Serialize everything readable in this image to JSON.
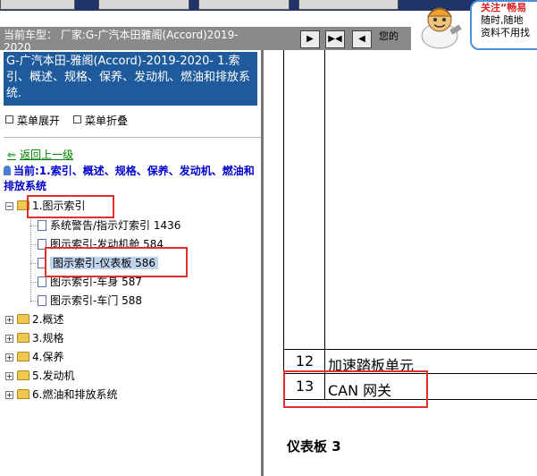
{
  "header": {
    "vehicle_label": "当前车型：",
    "vehicle_value": "厂家:G-广汽本田雅阁(Accord)2019-2020",
    "nav_buttons": [
      "▶",
      "▶◀",
      "◀"
    ],
    "trailing_text": "您的",
    "promo_line1": "关注“畅易",
    "promo_line2": "随时,随地",
    "promo_line3": "资料不用找"
  },
  "sidebar": {
    "chapter_title": "G-广汽本田-雅阁(Accord)-2019-2020- 1.索引、概述、规格、保养、发动机、燃油和排放系统.",
    "expand_label": "菜单展开",
    "collapse_label": "菜单折叠",
    "back_label": "返回上一级",
    "current_label": "当前:1.索引、概述、规格、保养、发动机、燃油和排放系统",
    "tree": [
      {
        "label": "1.图示索引"
      },
      {
        "label": "系统警告/指示灯索引 1436"
      },
      {
        "label": "图示索引-发动机舱 584"
      },
      {
        "label": "图示索引-仪表板 586"
      },
      {
        "label": "图示索引-车身 587"
      },
      {
        "label": "图示索引-车门 588"
      },
      {
        "label": "2.概述"
      },
      {
        "label": "3.规格"
      },
      {
        "label": "4.保养"
      },
      {
        "label": "5.发动机"
      },
      {
        "label": "6.燃油和排放系统"
      }
    ]
  },
  "content": {
    "rows": [
      {
        "num": "12",
        "name": "加速踏板单元"
      },
      {
        "num": "13",
        "name": "CAN 网关"
      }
    ],
    "section_heading": "仪表板 3"
  }
}
